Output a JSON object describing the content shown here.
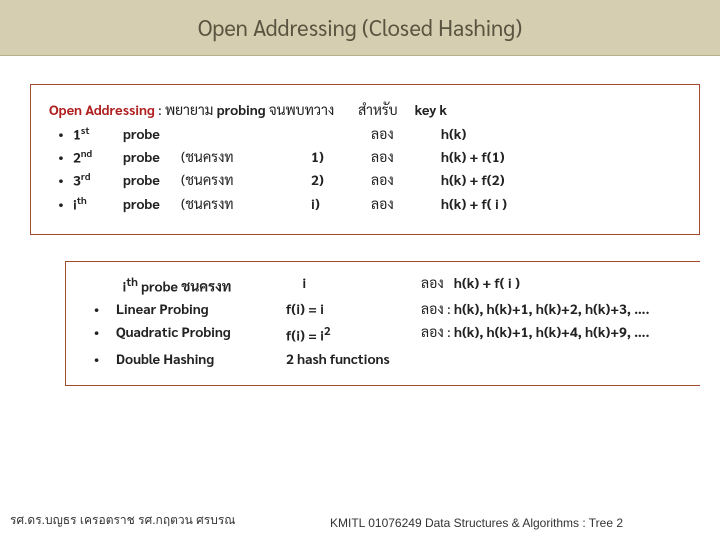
{
  "title": "Open Addressing (Closed Hashing)",
  "box1": {
    "headline": {
      "lead": "Open Addressing",
      "colon": " : ",
      "try_text": "พยายาม ",
      "probing": "probing",
      "until": " จนพบทวาง",
      "for_text": "สำหรับ",
      "key": "key k"
    },
    "rows": [
      {
        "bullet": "•",
        "ord": "1",
        "sup": "st",
        "label": "probe",
        "paren": "",
        "arg": "",
        "long": "ลอง",
        "formula": "h(k)"
      },
      {
        "bullet": "•",
        "ord": "2",
        "sup": "nd",
        "label": "probe",
        "paren": "(ชนครงท",
        "arg": "1)",
        "long": "ลอง",
        "formula": "h(k) + f(1)"
      },
      {
        "bullet": "•",
        "ord": "3",
        "sup": "rd",
        "label": "probe",
        "paren": "(ชนครงท",
        "arg": "2)",
        "long": "ลอง",
        "formula": "h(k) + f(2)"
      },
      {
        "bullet": "•",
        "ord": "i",
        "sup": "th",
        "label": "probe",
        "paren": "(ชนครงท",
        "arg": "i)",
        "long": "ลอง",
        "formula": "h(k) + f( i )"
      }
    ]
  },
  "box2": {
    "head": {
      "ith": "i",
      "ith_sup": "th",
      "probe_label": "   probe ชนครงท",
      "i": "i",
      "long": "ลอง",
      "formula": "h(k) + f( i )"
    },
    "rows": [
      {
        "bullet": "•",
        "name": "Linear Probing",
        "eq": "f(i) = i",
        "long": "ลอง : ",
        "seq": "h(k),  h(k)+1,  h(k)+2,  h(k)+3, …."
      },
      {
        "bullet": "•",
        "name": "Quadratic Probing",
        "eq": "f(i) = i",
        "sup": "2",
        "long": "ลอง : ",
        "seq": "h(k),  h(k)+1,  h(k)+4,  h(k)+9, …."
      },
      {
        "bullet": "•",
        "name": "Double Hashing",
        "eq": "2 hash functions",
        "long": "",
        "seq": ""
      }
    ]
  },
  "footer": {
    "left": "รศ.ดร.บญธร     เครอตราช     รศ.กฤตวน   ศรบรณ",
    "right": "KMITL   01076249 Data Structures & Algorithms : Tree 2"
  }
}
